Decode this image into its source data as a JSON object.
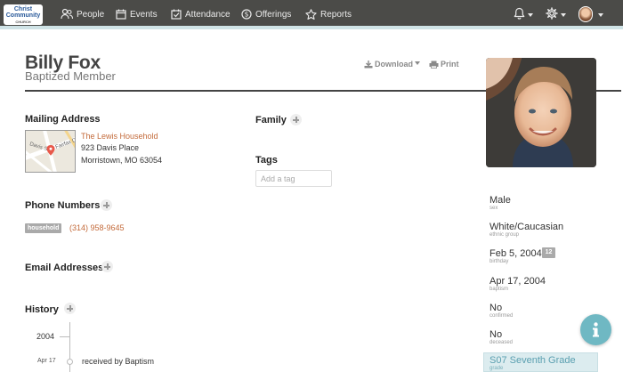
{
  "nav": {
    "logo": {
      "line1": "Christ",
      "line2": "Community",
      "line3": "CHURCH"
    },
    "items": [
      {
        "label": "People",
        "icon": "people-icon"
      },
      {
        "label": "Events",
        "icon": "calendar-icon"
      },
      {
        "label": "Attendance",
        "icon": "checkbox-calendar-icon"
      },
      {
        "label": "Offerings",
        "icon": "dollar-coin-icon"
      },
      {
        "label": "Reports",
        "icon": "star-icon"
      }
    ],
    "right_icons": [
      "bell-icon",
      "gear-icon",
      "user-avatar"
    ]
  },
  "person": {
    "name": "Billy Fox",
    "status": "Baptized Member"
  },
  "actions": {
    "download": "Download",
    "print": "Print"
  },
  "mailing": {
    "title": "Mailing Address",
    "household": "The Lewis Household",
    "street": "923 Davis Place",
    "city": "Morristown, MO  63054",
    "map_labels": [
      "Davis St",
      "Fairfax Dr"
    ]
  },
  "phones": {
    "title": "Phone Numbers",
    "type": "household",
    "number": "(314) 958-9645"
  },
  "email": {
    "title": "Email Addresses"
  },
  "family": {
    "title": "Family"
  },
  "tags": {
    "title": "Tags",
    "placeholder": "Add a tag"
  },
  "history": {
    "title": "History",
    "year": "2004",
    "date": "Apr 17",
    "event": "received by Baptism"
  },
  "attributes": [
    {
      "value": "Male",
      "label": "sex"
    },
    {
      "value": "White/Caucasian",
      "label": "ethnic group"
    },
    {
      "value": "Feb 5, 2004",
      "label": "birthday",
      "badge": "12"
    },
    {
      "value": "Apr 17, 2004",
      "label": "baptism"
    },
    {
      "value": "No",
      "label": "confirmed"
    },
    {
      "value": "No",
      "label": "deceased"
    },
    {
      "value": "S07 Seventh Grade",
      "label": "grade"
    }
  ],
  "colors": {
    "nav_bg": "#4b4b48",
    "link": "#c36a3a",
    "accent": "#6fb8c3",
    "grade_bg": "#dcecef"
  }
}
